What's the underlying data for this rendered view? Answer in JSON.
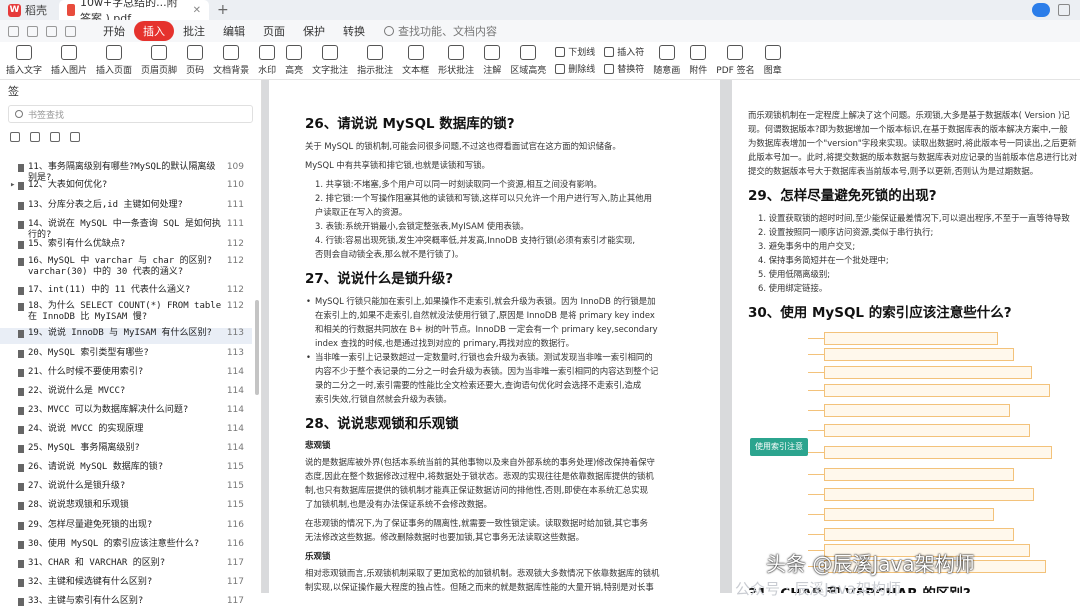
{
  "titlebar": {
    "app_name": "稻壳",
    "tab_title": "10w+字总结的...附答案 ).pdf",
    "plus": "+"
  },
  "menubar": {
    "items": [
      "开始",
      "插入",
      "批注",
      "编辑",
      "页面",
      "保护",
      "转换"
    ],
    "active": "插入",
    "search_placeholder": "查找功能、文档内容"
  },
  "ribbon": {
    "tools": [
      "插入文字",
      "插入图片",
      "插入页面",
      "页眉页脚",
      "页码",
      "文档背景",
      "水印",
      "高亮",
      "文字批注",
      "指示批注",
      "文本框",
      "形状批注",
      "注解",
      "区域高亮"
    ],
    "small_tools_a": [
      "下划线",
      "删除线"
    ],
    "small_tools_b": [
      "插入符",
      "替换符"
    ],
    "tools_end": [
      "随意画",
      "附件",
      "PDF 签名",
      "图章"
    ]
  },
  "sidebar": {
    "header": "签",
    "search_placeholder": "书签查找",
    "bookmarks": [
      {
        "title": "11、事务隔离级别有哪些?MySQL的默认隔离级别是?",
        "page": "109",
        "chev": ""
      },
      {
        "title": "12、大表如何优化?",
        "page": "110",
        "chev": "▸"
      },
      {
        "title": "13、分库分表之后,id 主键如何处理?",
        "page": "111",
        "chev": ""
      },
      {
        "title": "14、说说在 MySQL 中一条查询 SQL 是如何执行的?",
        "page": "111",
        "chev": ""
      },
      {
        "title": "15、索引有什么优缺点?",
        "page": "112",
        "chev": ""
      },
      {
        "title": "16、MySQL 中 varchar 与 char 的区别?varchar(30) 中的 30 代表的涵义?",
        "page": "112",
        "chev": ""
      },
      {
        "title": "17、int(11) 中的 11 代表什么涵义?",
        "page": "112",
        "chev": ""
      },
      {
        "title": "18、为什么 SELECT COUNT(*) FROM table 在 InnoDB 比 MyISAM 慢?",
        "page": "112",
        "chev": ""
      },
      {
        "title": "19、说说 InnoDB 与 MyISAM 有什么区别?",
        "page": "113",
        "chev": "",
        "selected": true
      },
      {
        "title": "20、MySQL 索引类型有哪些?",
        "page": "113",
        "chev": ""
      },
      {
        "title": "21、什么时候不要使用索引?",
        "page": "114",
        "chev": ""
      },
      {
        "title": "22、说说什么是 MVCC?",
        "page": "114",
        "chev": ""
      },
      {
        "title": "23、MVCC 可以为数据库解决什么问题?",
        "page": "114",
        "chev": ""
      },
      {
        "title": "24、说说 MVCC 的实现原理",
        "page": "114",
        "chev": ""
      },
      {
        "title": "25、MySQL 事务隔离级别?",
        "page": "114",
        "chev": ""
      },
      {
        "title": "26、请说说 MySQL 数据库的锁?",
        "page": "115",
        "chev": ""
      },
      {
        "title": "27、说说什么是锁升级?",
        "page": "115",
        "chev": ""
      },
      {
        "title": "28、说说悲观锁和乐观锁",
        "page": "115",
        "chev": ""
      },
      {
        "title": "29、怎样尽量避免死锁的出现?",
        "page": "116",
        "chev": ""
      },
      {
        "title": "30、使用 MySQL 的索引应该注意些什么?",
        "page": "116",
        "chev": ""
      },
      {
        "title": "31、CHAR 和 VARCHAR 的区别?",
        "page": "117",
        "chev": ""
      },
      {
        "title": "32、主键和候选键有什么区别?",
        "page": "117",
        "chev": ""
      },
      {
        "title": "33、主键与索引有什么区别?",
        "page": "117",
        "chev": ""
      }
    ]
  },
  "page1": {
    "h26": "26、请说说 MySQL 数据库的锁?",
    "p26a": "关于 MySQL 的锁机制,可能会问很多问题,不过这也得看面试官在这方面的知识储备。",
    "p26b": "MySQL 中有共享锁和排它锁,也就是读锁和写锁。",
    "l26": [
      "1. 共享锁:不堵塞,多个用户可以同一时刻读取同一个资源,相互之间没有影响。",
      "2. 排它锁:一个写操作阻塞其他的读锁和写锁,这样可以只允许一个用户进行写入,防止其他用",
      "   户读取正在写入的资源。",
      "3. 表锁:系统开销最小,会锁定整张表,MyISAM 使用表锁。",
      "4. 行锁:容易出现死锁,发生冲突概率低,并发高,InnoDB 支持行锁(必须有索引才能实现,",
      "   否则会自动锁全表,那么就不是行锁了)。"
    ],
    "h27": "27、说说什么是锁升级?",
    "l27a": [
      "MySQL 行锁只能加在索引上,如果操作不走索引,就会升级为表锁。因为 InnoDB 的行锁是加",
      "在索引上的,如果不走索引,自然就没法使用行锁了,原因是 InnoDB 是将 primary key index",
      "和相关的行数据共同放在 B+ 树的叶节点。InnoDB 一定会有一个 primary key,secondary",
      "index 查找的时候,也是通过找到对应的 primary,再找对应的数据行。"
    ],
    "l27b": [
      "当非唯一索引上记录数超过一定数量时,行锁也会升级为表锁。测试发现当非唯一索引相同的",
      "内容不少于整个表记录的二分之一时会升级为表锁。因为当非唯一索引相同的内容达到整个记",
      "录的二分之一时,索引需要的性能比全文检索还要大,查询语句优化时会选择不走索引,造成",
      "索引失效,行锁自然就会升级为表锁。"
    ],
    "h28": "28、说说悲观锁和乐观锁",
    "s28a": "悲观锁",
    "p28a": [
      "说的是数据库被外界(包括本系统当前的其他事物以及来自外部系统的事务处理)修改保持着保守",
      "态度,因此在整个数据修改过程中,将数据处于锁状态。悲观的实现往往是依靠数据库提供的锁机",
      "制,也只有数据库层提供的锁机制才能真正保证数据访问的排他性,否则,即使在本系统汇总实现",
      "了加锁机制,也是没有办法保证系统不会修改数据。"
    ],
    "p28b": [
      "在悲观锁的情况下,为了保证事务的隔离性,就需要一致性锁定读。读取数据时给加锁,其它事务",
      "无法修改这些数据。修改删除数据时也要加锁,其它事务无法读取这些数据。"
    ],
    "s28b": "乐观锁",
    "p28c": [
      "相对悲观锁而言,乐观锁机制采取了更加宽松的加锁机制。悲观锁大多数情况下依靠数据库的锁机",
      "制实现,以保证操作最大程度的独占性。但随之而来的就是数据库性能的大量开销,特别是对长事"
    ]
  },
  "page2": {
    "top": [
      "而乐观锁机制在一定程度上解决了这个问题。乐观锁,大多是基于数据版本( Version )记",
      "现。何谓数据版本?即为数据增加一个版本标识,在基于数据库表的版本解决方案中,一般",
      "为数据库表增加一个\"version\"字段来实现。读取出数据时,将此版本号一同读出,之后更新",
      "此版本号加一。此时,将提交数据的版本数据与数据库表对应记录的当前版本信息进行比对",
      "提交的数据版本号大于数据库表当前版本号,则予以更新,否则认为是过期数据。"
    ],
    "h29": "29、怎样尽量避免死锁的出现?",
    "l29": [
      "1. 设置获取锁的超时时间,至少能保证最差情况下,可以退出程序,不至于一直等待导致",
      "2. 设置按照同一顺序访问资源,类似于串行执行;",
      "3. 避免事务中的用户交叉;",
      "4. 保持事务简短并在一个批处理中;",
      "5. 使用低隔离级别;",
      "6. 使用绑定链接。"
    ],
    "h30": "30、使用 MySQL 的索引应该注意些什么?",
    "mindmap_root": "使用索引注意",
    "h31": "31、CHAR 和 VARCHAR 的区别?"
  },
  "watermark": "头条 @辰溪Java架构师",
  "watermark2": "公众号 · 辰溪Java架构师"
}
